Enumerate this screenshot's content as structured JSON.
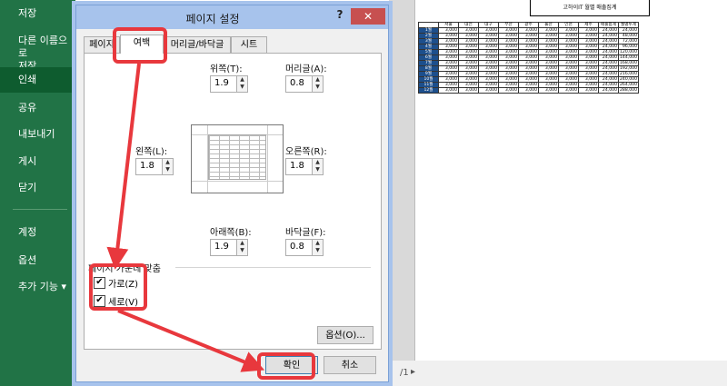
{
  "sidebar": {
    "items": [
      {
        "label": "저장"
      },
      {
        "label": "다른 이름으로\n저장"
      },
      {
        "label": "인쇄"
      },
      {
        "label": "공유"
      },
      {
        "label": "내보내기"
      },
      {
        "label": "게시"
      },
      {
        "label": "닫기"
      },
      {
        "label": "계정"
      },
      {
        "label": "옵션"
      },
      {
        "label": "추가 기능 ▾"
      }
    ]
  },
  "dialog": {
    "title": "페이지 설정",
    "help": "?",
    "close": "✕",
    "tabs": [
      {
        "label": "페이지"
      },
      {
        "label": "여백"
      },
      {
        "label": "머리글/바닥글"
      },
      {
        "label": "시트"
      }
    ],
    "fields": {
      "top": {
        "label": "위쪽(T):",
        "value": "1.9"
      },
      "header": {
        "label": "머리글(A):",
        "value": "0.8"
      },
      "left": {
        "label": "왼쪽(L):",
        "value": "1.8"
      },
      "right": {
        "label": "오른쪽(R):",
        "value": "1.8"
      },
      "bottom": {
        "label": "아래쪽(B):",
        "value": "1.9"
      },
      "footer": {
        "label": "바닥글(F):",
        "value": "0.8"
      }
    },
    "center_group": {
      "label": "페이지 가운데 맞춤",
      "horizontal": {
        "label": "가로(Z)",
        "checked": true
      },
      "vertical": {
        "label": "세로(V)",
        "checked": true
      }
    },
    "options_button": "옵션(O)...",
    "ok_button": "확인",
    "cancel_button": "취소"
  },
  "preview": {
    "title": "고하이IT 월별 매출집계",
    "headers": [
      "",
      "서울",
      "대전",
      "대구",
      "부산",
      "광주",
      "울산",
      "인천",
      "제주",
      "매출합계",
      "월별누계"
    ],
    "rows": [
      [
        "1월",
        "3,000",
        "3,000",
        "3,000",
        "3,000",
        "3,000",
        "3,000",
        "3,000",
        "3,000",
        "24,000",
        "24,000"
      ],
      [
        "2월",
        "3,000",
        "3,000",
        "3,000",
        "3,000",
        "3,000",
        "3,000",
        "3,000",
        "3,000",
        "24,000",
        "48,000"
      ],
      [
        "3월",
        "3,000",
        "3,000",
        "3,000",
        "3,000",
        "3,000",
        "3,000",
        "3,000",
        "3,000",
        "24,000",
        "72,000"
      ],
      [
        "4월",
        "3,000",
        "3,000",
        "3,000",
        "3,000",
        "3,000",
        "3,000",
        "3,000",
        "3,000",
        "24,000",
        "96,000"
      ],
      [
        "5월",
        "3,000",
        "3,000",
        "3,000",
        "3,000",
        "3,000",
        "3,000",
        "3,000",
        "3,000",
        "24,000",
        "120,000"
      ],
      [
        "6월",
        "3,000",
        "3,000",
        "3,000",
        "3,000",
        "3,000",
        "3,000",
        "3,000",
        "3,000",
        "24,000",
        "144,000"
      ],
      [
        "7월",
        "3,000",
        "3,000",
        "3,000",
        "3,000",
        "3,000",
        "3,000",
        "3,000",
        "3,000",
        "24,000",
        "168,000"
      ],
      [
        "8월",
        "3,000",
        "3,000",
        "3,000",
        "3,000",
        "3,000",
        "3,000",
        "3,000",
        "3,000",
        "24,000",
        "192,000"
      ],
      [
        "9월",
        "3,000",
        "3,000",
        "3,000",
        "3,000",
        "3,000",
        "3,000",
        "3,000",
        "3,000",
        "24,000",
        "216,000"
      ],
      [
        "10월",
        "3,000",
        "3,000",
        "3,000",
        "3,000",
        "3,000",
        "3,000",
        "3,000",
        "3,000",
        "24,000",
        "240,000"
      ],
      [
        "11월",
        "3,000",
        "3,000",
        "3,000",
        "3,000",
        "3,000",
        "3,000",
        "3,000",
        "3,000",
        "24,000",
        "264,000"
      ],
      [
        "12월",
        "3,000",
        "3,000",
        "3,000",
        "3,000",
        "3,000",
        "3,000",
        "3,000",
        "3,000",
        "24,000",
        "288,000"
      ]
    ],
    "pager": "/1"
  },
  "colors": {
    "sidebar": "#217346",
    "annotation": "#e8383d",
    "dialog_frame": "#a7c3ec"
  }
}
